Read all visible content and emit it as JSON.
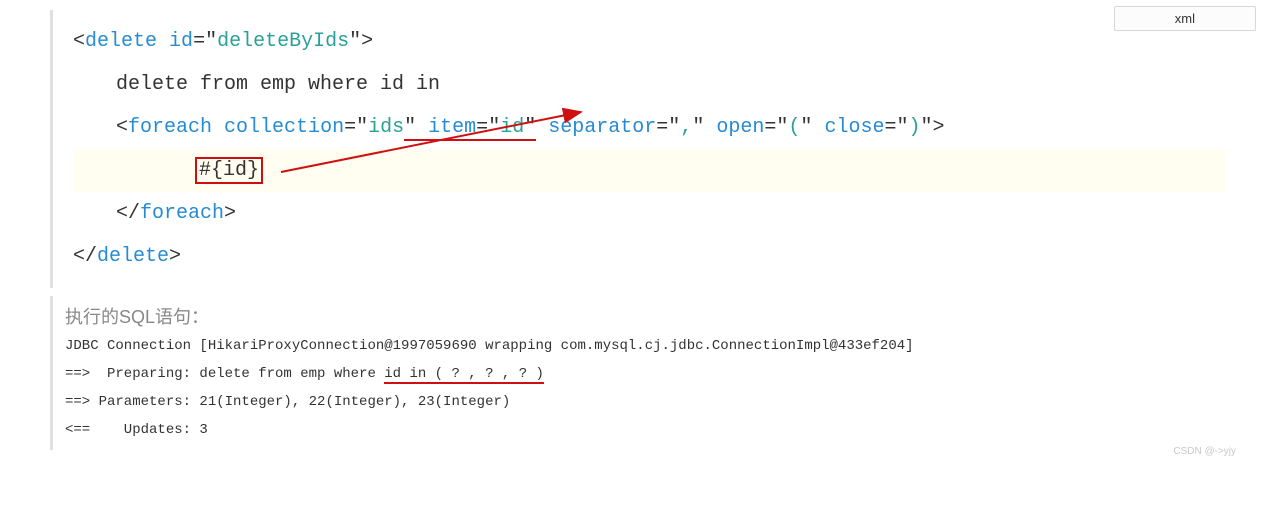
{
  "badge": "xml",
  "code": {
    "line1": {
      "p1": "<",
      "tag": "delete",
      "sp": " ",
      "attr": "id",
      "eq": "=",
      "q1": "\"",
      "val": "deleteByIds",
      "q2": "\"",
      "p2": ">"
    },
    "line2": "delete from emp where id in",
    "line3": {
      "p1": "<",
      "tag": "foreach",
      "attr1": "collection",
      "val1": "ids",
      "attr2": "item",
      "val2": "id",
      "attr3": "separator",
      "val3": ",",
      "attr4": "open",
      "val4": "(",
      "attr5": "close",
      "val5": ")",
      "p2": ">"
    },
    "line4": "#{id}",
    "line5": {
      "p1": "</",
      "tag": "foreach",
      "p2": ">"
    },
    "line6": {
      "p1": "</",
      "tag": "delete",
      "p2": ">"
    }
  },
  "out": {
    "label": "执行的SQL语句：",
    "l1": "JDBC Connection [HikariProxyConnection@1997059690 wrapping com.mysql.cj.jdbc.ConnectionImpl@433ef204]",
    "l2a": "==>  Preparing: delete from emp where ",
    "l2b": "id in ( ? , ? , ? )",
    "l3": "==> Parameters: 21(Integer), 22(Integer), 23(Integer)",
    "l4": "<==    Updates: 3"
  },
  "watermark": "CSDN @->yjy"
}
